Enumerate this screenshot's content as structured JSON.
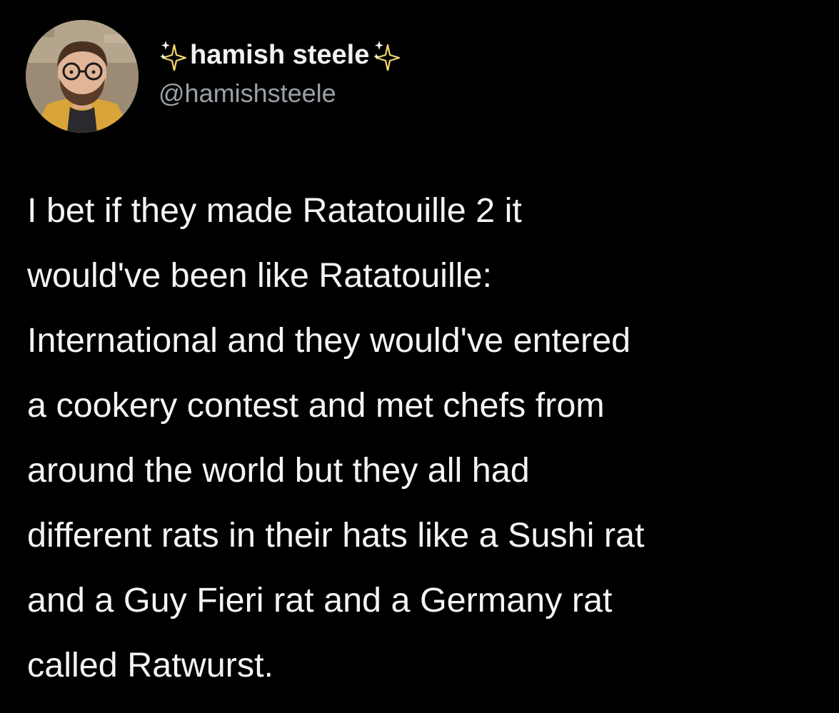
{
  "user": {
    "display_name": "hamish steele",
    "handle": "@hamishsteele",
    "avatar_icon": "profile-photo",
    "sparkle_icon": "sparkles-icon"
  },
  "tweet": {
    "lines": [
      "I bet if they made Ratatouille 2 it",
      "would've been like Ratatouille:",
      "International and they would've entered",
      "a cookery contest and met chefs from",
      "around the world but they all had",
      "different rats in their hats like a Sushi rat",
      "and a Guy Fieri rat and a Germany rat",
      "called Ratwurst."
    ]
  },
  "colors": {
    "background": "#000000",
    "text": "#f4f4f4",
    "handle": "#9aa0a6",
    "sparkle": "#f5d76e"
  }
}
